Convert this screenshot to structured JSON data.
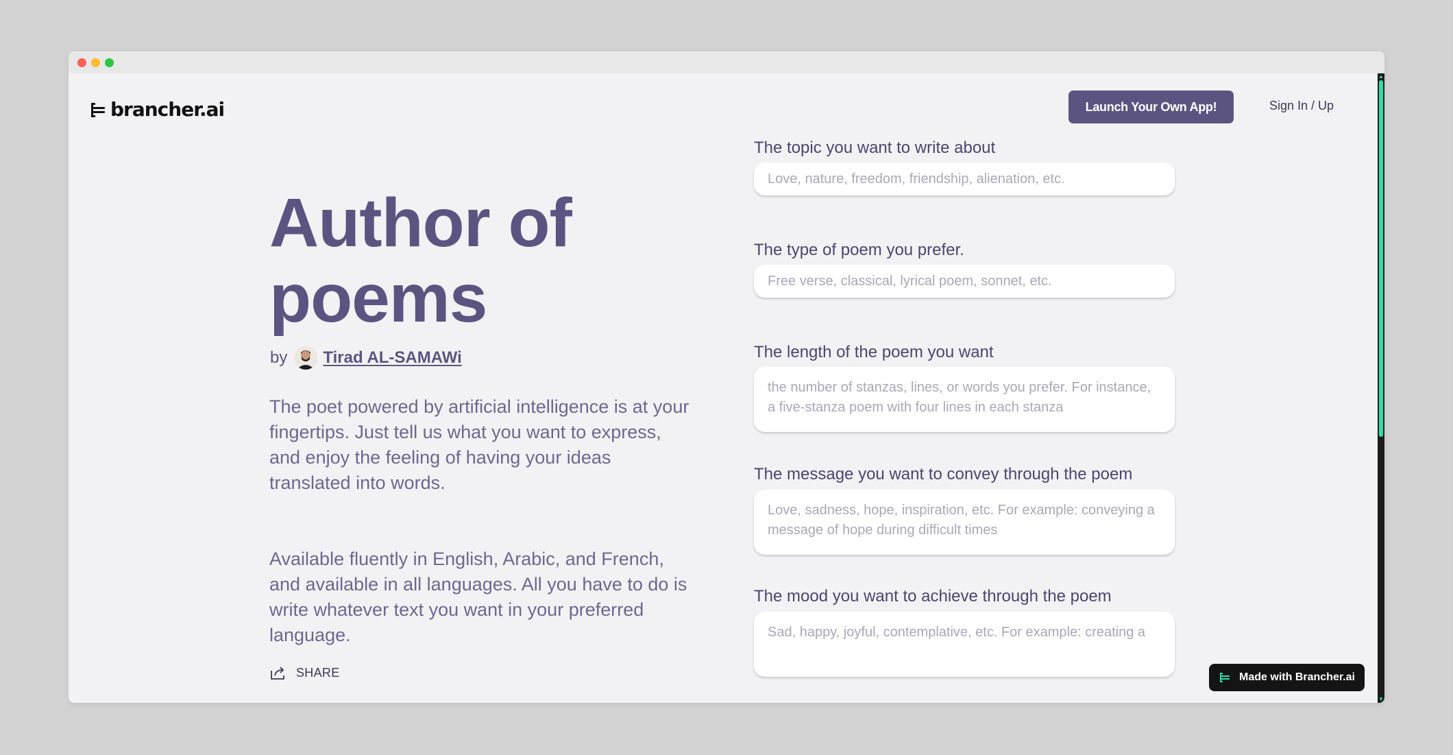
{
  "header": {
    "brand": "brancher.ai",
    "launch_label": "Launch Your Own App!",
    "signin_label": "Sign In / Up"
  },
  "hero": {
    "title": "Author of poems",
    "by_label": "by",
    "author_name": "Tirad AL-SAMAWi",
    "description_1": "The poet powered by artificial intelligence is at your fingertips. Just tell us what you want to express, and enjoy the feeling of having your ideas translated into words.",
    "description_2": "Available fluently in English, Arabic, and French, and available in all languages. All you have to do is write whatever text you want in your preferred language.",
    "share_label": "SHARE"
  },
  "form": {
    "fields": [
      {
        "label": "The topic you want to write about",
        "placeholder": "Love, nature, freedom, friendship, alienation, etc."
      },
      {
        "label": "The type of poem you prefer.",
        "placeholder": "Free verse, classical, lyrical poem, sonnet, etc."
      },
      {
        "label": "The length of the poem you want",
        "placeholder": "the number of stanzas, lines, or words you prefer. For instance, a five-stanza poem with four lines in each stanza"
      },
      {
        "label": "The message you want to convey through the poem",
        "placeholder": "Love, sadness, hope, inspiration, etc. For example: conveying a message of hope during difficult times"
      },
      {
        "label": "The mood you want to achieve through the poem",
        "placeholder": "Sad, happy, joyful, contemplative, etc. For example: creating a"
      }
    ]
  },
  "badge": {
    "label": "Made with Brancher.ai"
  },
  "icons": {
    "logo": "brancher-logo-icon",
    "share": "share-icon",
    "badge": "brancher-mark-icon"
  },
  "colors": {
    "accent": "#5c5480",
    "background": "#f2f2f4",
    "scrollbar_thumb": "#2fe0a8"
  }
}
